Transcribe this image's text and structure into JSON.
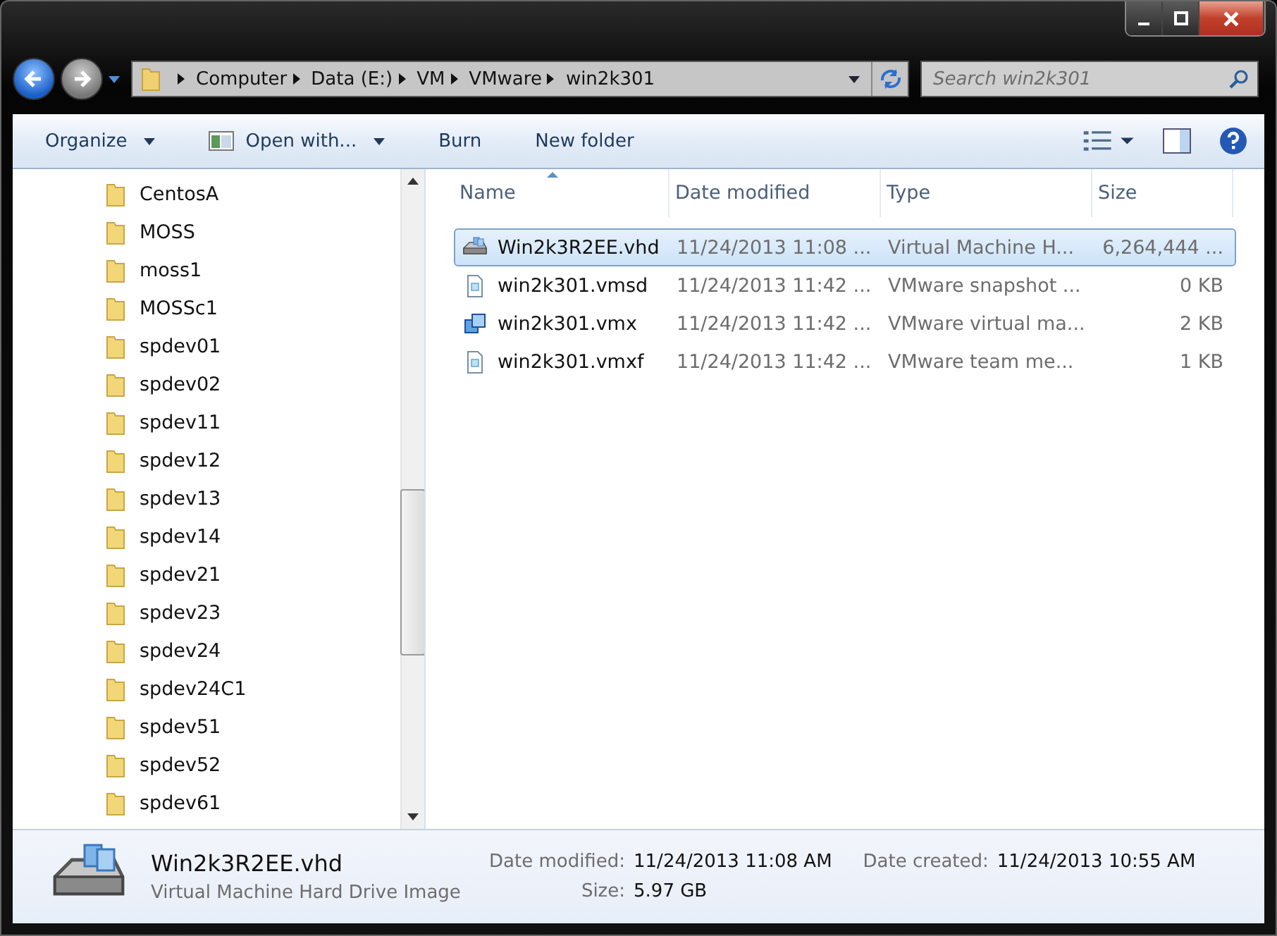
{
  "address": {
    "crumbs": [
      "Computer",
      "Data (E:)",
      "VM",
      "VMware",
      "win2k301"
    ]
  },
  "search": {
    "placeholder": "Search win2k301"
  },
  "toolbar": [
    {
      "label": "Organize",
      "dropdown": true
    },
    {
      "label": "Open with...",
      "dropdown": true
    },
    {
      "label": "Burn",
      "dropdown": false
    },
    {
      "label": "New folder",
      "dropdown": false
    }
  ],
  "nav": {
    "folders": [
      "CentosA",
      "MOSS",
      "moss1",
      "MOSSc1",
      "spdev01",
      "spdev02",
      "spdev11",
      "spdev12",
      "spdev13",
      "spdev14",
      "spdev21",
      "spdev23",
      "spdev24",
      "spdev24C1",
      "spdev51",
      "spdev52",
      "spdev61"
    ]
  },
  "columns": [
    {
      "label": "Name",
      "sorted": true
    },
    {
      "label": "Date modified",
      "sorted": false
    },
    {
      "label": "Type",
      "sorted": false
    },
    {
      "label": "Size",
      "sorted": false
    }
  ],
  "files": [
    {
      "name": "Win2k3R2EE.vhd",
      "date": "11/24/2013 11:08 ...",
      "type": "Virtual Machine H...",
      "size": "6,264,444 ...",
      "kind": "disk",
      "selected": true
    },
    {
      "name": "win2k301.vmsd",
      "date": "11/24/2013 11:42 ...",
      "type": "VMware snapshot ...",
      "size": "0 KB",
      "kind": "doc",
      "selected": false
    },
    {
      "name": "win2k301.vmx",
      "date": "11/24/2013 11:42 ...",
      "type": "VMware virtual ma...",
      "size": "2 KB",
      "kind": "vm",
      "selected": false
    },
    {
      "name": "win2k301.vmxf",
      "date": "11/24/2013 11:42 ...",
      "type": "VMware team me...",
      "size": "1 KB",
      "kind": "doc",
      "selected": false
    }
  ],
  "details": {
    "name": "Win2k3R2EE.vhd",
    "type": "Virtual Machine Hard Drive Image",
    "fields": [
      {
        "label": "Date modified:",
        "value": "11/24/2013 11:08 AM"
      },
      {
        "label": "Date created:",
        "value": "11/24/2013 10:55 AM"
      },
      {
        "label": "Size:",
        "value": "5.97 GB"
      }
    ]
  }
}
